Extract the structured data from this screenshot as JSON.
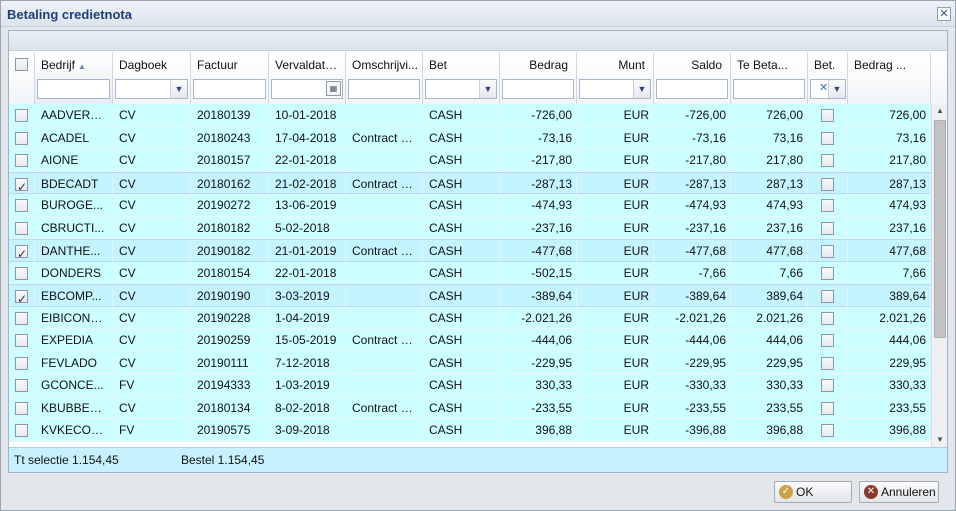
{
  "window": {
    "title": "Betaling credietnota",
    "close_icon": "close-icon"
  },
  "columns": [
    {
      "key": "select",
      "label": ""
    },
    {
      "key": "bedrijf",
      "label": "Bedrijf",
      "sorted": "asc"
    },
    {
      "key": "dagboek",
      "label": "Dagboek"
    },
    {
      "key": "factuur",
      "label": "Factuur"
    },
    {
      "key": "vervaldatum",
      "label": "Vervaldatum"
    },
    {
      "key": "omschrijving",
      "label": "Omschrijvi..."
    },
    {
      "key": "bet",
      "label": "Bet"
    },
    {
      "key": "bedrag",
      "label": "Bedrag"
    },
    {
      "key": "munt",
      "label": "Munt"
    },
    {
      "key": "saldo",
      "label": "Saldo"
    },
    {
      "key": "te_betalen",
      "label": "Te Beta..."
    },
    {
      "key": "bet2",
      "label": "Bet."
    },
    {
      "key": "bedrag2",
      "label": "Bedrag ..."
    }
  ],
  "rows": [
    {
      "checked": false,
      "bedrijf": "AADVERT...",
      "dagboek": "CV",
      "factuur": "20180139",
      "vervaldatum": "10-01-2018",
      "omschrijving": "",
      "bet": "CASH",
      "bedrag": "-726,00",
      "munt": "EUR",
      "saldo": "-726,00",
      "te_betalen": "726,00",
      "bedrag2": "726,00"
    },
    {
      "checked": false,
      "bedrijf": "ACADEL",
      "dagboek": "CV",
      "factuur": "20180243",
      "vervaldatum": "17-04-2018",
      "omschrijving": "Contract 3...",
      "bet": "CASH",
      "bedrag": "-73,16",
      "munt": "EUR",
      "saldo": "-73,16",
      "te_betalen": "73,16",
      "bedrag2": "73,16"
    },
    {
      "checked": false,
      "bedrijf": "AIONE",
      "dagboek": "CV",
      "factuur": "20180157",
      "vervaldatum": "22-01-2018",
      "omschrijving": "",
      "bet": "CASH",
      "bedrag": "-217,80",
      "munt": "EUR",
      "saldo": "-217,80",
      "te_betalen": "217,80",
      "bedrag2": "217,80"
    },
    {
      "checked": true,
      "bedrijf": "BDECADT",
      "dagboek": "CV",
      "factuur": "20180162",
      "vervaldatum": "21-02-2018",
      "omschrijving": "Contract 1...",
      "bet": "CASH",
      "bedrag": "-287,13",
      "munt": "EUR",
      "saldo": "-287,13",
      "te_betalen": "287,13",
      "bedrag2": "287,13"
    },
    {
      "checked": false,
      "bedrijf": "BUROGE...",
      "dagboek": "CV",
      "factuur": "20190272",
      "vervaldatum": "13-06-2019",
      "omschrijving": "",
      "bet": "CASH",
      "bedrag": "-474,93",
      "munt": "EUR",
      "saldo": "-474,93",
      "te_betalen": "474,93",
      "bedrag2": "474,93"
    },
    {
      "checked": false,
      "bedrijf": "CBRUCTI...",
      "dagboek": "CV",
      "factuur": "20180182",
      "vervaldatum": "5-02-2018",
      "omschrijving": "",
      "bet": "CASH",
      "bedrag": "-237,16",
      "munt": "EUR",
      "saldo": "-237,16",
      "te_betalen": "237,16",
      "bedrag2": "237,16"
    },
    {
      "checked": true,
      "bedrijf": "DANTHE...",
      "dagboek": "CV",
      "factuur": "20190182",
      "vervaldatum": "21-01-2019",
      "omschrijving": "Contract 3...",
      "bet": "CASH",
      "bedrag": "-477,68",
      "munt": "EUR",
      "saldo": "-477,68",
      "te_betalen": "477,68",
      "bedrag2": "477,68"
    },
    {
      "checked": false,
      "bedrijf": "DONDERS",
      "dagboek": "CV",
      "factuur": "20180154",
      "vervaldatum": "22-01-2018",
      "omschrijving": "",
      "bet": "CASH",
      "bedrag": "-502,15",
      "munt": "EUR",
      "saldo": "-7,66",
      "te_betalen": "7,66",
      "bedrag2": "7,66"
    },
    {
      "checked": true,
      "bedrijf": "EBCOMP...",
      "dagboek": "CV",
      "factuur": "20190190",
      "vervaldatum": "3-03-2019",
      "omschrijving": "",
      "bet": "CASH",
      "bedrag": "-389,64",
      "munt": "EUR",
      "saldo": "-389,64",
      "te_betalen": "389,64",
      "bedrag2": "389,64"
    },
    {
      "checked": false,
      "bedrijf": "EIBICONT...",
      "dagboek": "CV",
      "factuur": "20190228",
      "vervaldatum": "1-04-2019",
      "omschrijving": "",
      "bet": "CASH",
      "bedrag": "-2.021,26",
      "munt": "EUR",
      "saldo": "-2.021,26",
      "te_betalen": "2.021,26",
      "bedrag2": "2.021,26"
    },
    {
      "checked": false,
      "bedrijf": "EXPEDIA",
      "dagboek": "CV",
      "factuur": "20190259",
      "vervaldatum": "15-05-2019",
      "omschrijving": "Contract 3...",
      "bet": "CASH",
      "bedrag": "-444,06",
      "munt": "EUR",
      "saldo": "-444,06",
      "te_betalen": "444,06",
      "bedrag2": "444,06"
    },
    {
      "checked": false,
      "bedrijf": "FEVLADO",
      "dagboek": "CV",
      "factuur": "20190111",
      "vervaldatum": "7-12-2018",
      "omschrijving": "",
      "bet": "CASH",
      "bedrag": "-229,95",
      "munt": "EUR",
      "saldo": "-229,95",
      "te_betalen": "229,95",
      "bedrag2": "229,95"
    },
    {
      "checked": false,
      "bedrijf": "GCONCE...",
      "dagboek": "FV",
      "factuur": "20194333",
      "vervaldatum": "1-03-2019",
      "omschrijving": "",
      "bet": "CASH",
      "bedrag": "330,33",
      "munt": "EUR",
      "saldo": "-330,33",
      "te_betalen": "330,33",
      "bedrag2": "330,33"
    },
    {
      "checked": false,
      "bedrijf": "KBUBBEL...",
      "dagboek": "CV",
      "factuur": "20180134",
      "vervaldatum": "8-02-2018",
      "omschrijving": "Contract 3...",
      "bet": "CASH",
      "bedrag": "-233,55",
      "munt": "EUR",
      "saldo": "-233,55",
      "te_betalen": "233,55",
      "bedrag2": "233,55"
    },
    {
      "checked": false,
      "bedrijf": "KVKECOSO",
      "dagboek": "FV",
      "factuur": "20190575",
      "vervaldatum": "3-09-2018",
      "omschrijving": "",
      "bet": "CASH",
      "bedrag": "396,88",
      "munt": "EUR",
      "saldo": "-396,88",
      "te_betalen": "396,88",
      "bedrag2": "396,88"
    }
  ],
  "summary": {
    "selectie": "Tt selectie  1.154,45",
    "bestel": "Bestel  1.154,45"
  },
  "buttons": {
    "ok": "OK",
    "cancel": "Annuleren"
  },
  "icons": {
    "ok": "ok-icon",
    "cancel": "cancel-icon",
    "dropdown": "chevron-down-icon",
    "calendar": "calendar-icon",
    "clear": "clear-filter-icon"
  },
  "colors": {
    "row_bg": "#ccffff",
    "title": "#1c3f7a",
    "summary_bg": "#c6f2ff"
  }
}
